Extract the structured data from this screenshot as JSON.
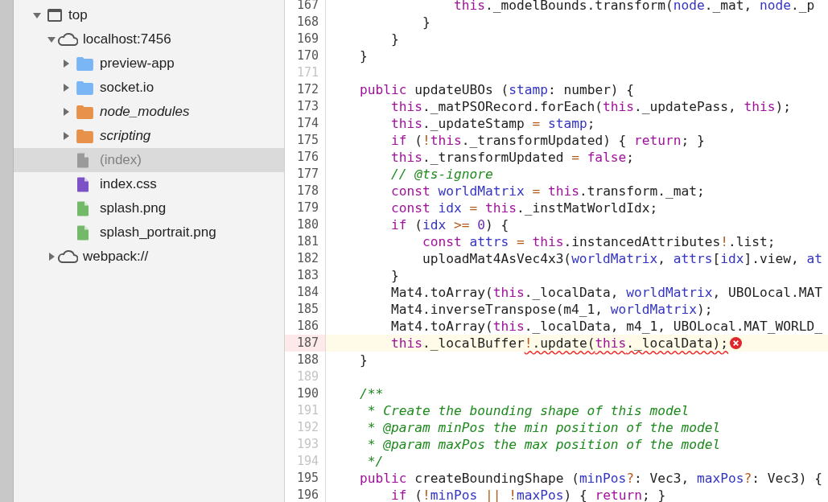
{
  "navigator": {
    "tree": [
      {
        "label": "top",
        "kind": "frame",
        "expanded": true,
        "selected": false,
        "italic": false,
        "children": [
          {
            "label": "localhost:7456",
            "kind": "origin",
            "expanded": true,
            "selected": false,
            "italic": false,
            "children": [
              {
                "label": "preview-app",
                "kind": "folder",
                "expanded": false,
                "selected": false,
                "italic": false,
                "color": "#7ab6f5"
              },
              {
                "label": "socket.io",
                "kind": "folder",
                "expanded": false,
                "selected": false,
                "italic": false,
                "color": "#7ab6f5"
              },
              {
                "label": "node_modules",
                "kind": "folder",
                "expanded": false,
                "selected": false,
                "italic": true,
                "color": "#e8914a"
              },
              {
                "label": "scripting",
                "kind": "folder",
                "expanded": false,
                "selected": false,
                "italic": true,
                "color": "#e8914a"
              },
              {
                "label": "(index)",
                "kind": "file",
                "selected": true,
                "italic": false,
                "color": "#9a9a9a"
              },
              {
                "label": "index.css",
                "kind": "file",
                "selected": false,
                "italic": false,
                "color": "#7d52c7"
              },
              {
                "label": "splash.png",
                "kind": "file",
                "selected": false,
                "italic": false,
                "color": "#74b86a"
              },
              {
                "label": "splash_portrait.png",
                "kind": "file",
                "selected": false,
                "italic": false,
                "color": "#74b86a"
              }
            ]
          },
          {
            "label": "webpack://",
            "kind": "origin",
            "expanded": false,
            "selected": false,
            "italic": false
          }
        ]
      }
    ]
  },
  "editor": {
    "lines": [
      {
        "n": "167",
        "dim": false,
        "error": false,
        "tokens": [
          {
            "t": "                this",
            "kind": "keyword"
          },
          {
            "t": "._modelBounds.transform(",
            "kind": "plain"
          },
          {
            "t": "node",
            "kind": "variable"
          },
          {
            "t": "._mat, ",
            "kind": "plain"
          },
          {
            "t": "node",
            "kind": "variable"
          },
          {
            "t": "._p",
            "kind": "plain"
          }
        ]
      },
      {
        "n": "168",
        "dim": false,
        "error": false,
        "tokens": [
          {
            "t": "            }",
            "kind": "plain"
          }
        ]
      },
      {
        "n": "169",
        "dim": false,
        "error": false,
        "tokens": [
          {
            "t": "        }",
            "kind": "plain"
          }
        ]
      },
      {
        "n": "170",
        "dim": false,
        "error": false,
        "tokens": [
          {
            "t": "    }",
            "kind": "plain"
          }
        ]
      },
      {
        "n": "171",
        "dim": true,
        "error": false
      },
      {
        "n": "172",
        "dim": false,
        "error": false,
        "tokens": [
          {
            "t": "    public",
            "kind": "keyword"
          },
          {
            "t": " updateUBOs (",
            "kind": "plain"
          },
          {
            "t": "stamp",
            "kind": "variable"
          },
          {
            "t": ": number) {",
            "kind": "plain"
          }
        ]
      },
      {
        "n": "173",
        "dim": false,
        "error": false,
        "tokens": [
          {
            "t": "        this",
            "kind": "keyword"
          },
          {
            "t": "._matPSORecord.forEach(",
            "kind": "plain"
          },
          {
            "t": "this",
            "kind": "keyword"
          },
          {
            "t": "._updatePass, ",
            "kind": "plain"
          },
          {
            "t": "this",
            "kind": "keyword"
          },
          {
            "t": ");",
            "kind": "plain"
          }
        ]
      },
      {
        "n": "174",
        "dim": false,
        "error": false,
        "tokens": [
          {
            "t": "        this",
            "kind": "keyword"
          },
          {
            "t": "._updateStamp ",
            "kind": "plain"
          },
          {
            "t": "= ",
            "kind": "operator"
          },
          {
            "t": "stamp",
            "kind": "variable"
          },
          {
            "t": ";",
            "kind": "plain"
          }
        ]
      },
      {
        "n": "175",
        "dim": false,
        "error": false,
        "tokens": [
          {
            "t": "        if",
            "kind": "keyword"
          },
          {
            "t": " (",
            "kind": "plain"
          },
          {
            "t": "!",
            "kind": "operator"
          },
          {
            "t": "this",
            "kind": "keyword"
          },
          {
            "t": "._transformUpdated) { ",
            "kind": "plain"
          },
          {
            "t": "return",
            "kind": "keyword"
          },
          {
            "t": "; }",
            "kind": "plain"
          }
        ]
      },
      {
        "n": "176",
        "dim": false,
        "error": false,
        "tokens": [
          {
            "t": "        this",
            "kind": "keyword"
          },
          {
            "t": "._transformUpdated ",
            "kind": "plain"
          },
          {
            "t": "= ",
            "kind": "operator"
          },
          {
            "t": "false",
            "kind": "keyword"
          },
          {
            "t": ";",
            "kind": "plain"
          }
        ]
      },
      {
        "n": "177",
        "dim": false,
        "error": false,
        "tokens": [
          {
            "t": "        // @ts-ignore",
            "kind": "comment"
          }
        ]
      },
      {
        "n": "178",
        "dim": false,
        "error": false,
        "tokens": [
          {
            "t": "        const",
            "kind": "keyword"
          },
          {
            "t": " worldMatrix",
            "kind": "variable"
          },
          {
            "t": " = ",
            "kind": "operator"
          },
          {
            "t": "this",
            "kind": "keyword"
          },
          {
            "t": ".transform._mat;",
            "kind": "plain"
          }
        ]
      },
      {
        "n": "179",
        "dim": false,
        "error": false,
        "tokens": [
          {
            "t": "        const",
            "kind": "keyword"
          },
          {
            "t": " idx",
            "kind": "variable"
          },
          {
            "t": " = ",
            "kind": "operator"
          },
          {
            "t": "this",
            "kind": "keyword"
          },
          {
            "t": "._instMatWorldIdx;",
            "kind": "plain"
          }
        ]
      },
      {
        "n": "180",
        "dim": false,
        "error": false,
        "tokens": [
          {
            "t": "        if",
            "kind": "keyword"
          },
          {
            "t": " (",
            "kind": "plain"
          },
          {
            "t": "idx",
            "kind": "variable"
          },
          {
            "t": " >= ",
            "kind": "operator"
          },
          {
            "t": "0",
            "kind": "number"
          },
          {
            "t": ") {",
            "kind": "plain"
          }
        ]
      },
      {
        "n": "181",
        "dim": false,
        "error": false,
        "tokens": [
          {
            "t": "            const",
            "kind": "keyword"
          },
          {
            "t": " attrs",
            "kind": "variable"
          },
          {
            "t": " = ",
            "kind": "operator"
          },
          {
            "t": "this",
            "kind": "keyword"
          },
          {
            "t": ".instancedAttributes",
            "kind": "plain"
          },
          {
            "t": "!",
            "kind": "operator"
          },
          {
            "t": ".list;",
            "kind": "plain"
          }
        ]
      },
      {
        "n": "182",
        "dim": false,
        "error": false,
        "tokens": [
          {
            "t": "            uploadMat4AsVec4x3(",
            "kind": "plain"
          },
          {
            "t": "worldMatrix",
            "kind": "variable"
          },
          {
            "t": ", ",
            "kind": "plain"
          },
          {
            "t": "attrs",
            "kind": "variable"
          },
          {
            "t": "[",
            "kind": "plain"
          },
          {
            "t": "idx",
            "kind": "variable"
          },
          {
            "t": "].view, ",
            "kind": "plain"
          },
          {
            "t": "at",
            "kind": "variable"
          }
        ]
      },
      {
        "n": "183",
        "dim": false,
        "error": false,
        "tokens": [
          {
            "t": "        }",
            "kind": "plain"
          }
        ]
      },
      {
        "n": "184",
        "dim": false,
        "error": false,
        "tokens": [
          {
            "t": "        Mat4.toArray(",
            "kind": "plain"
          },
          {
            "t": "this",
            "kind": "keyword"
          },
          {
            "t": "._localData, ",
            "kind": "plain"
          },
          {
            "t": "worldMatrix",
            "kind": "variable"
          },
          {
            "t": ", UBOLocal.MAT",
            "kind": "plain"
          }
        ]
      },
      {
        "n": "185",
        "dim": false,
        "error": false,
        "tokens": [
          {
            "t": "        Mat4.inverseTranspose(m4_1, ",
            "kind": "plain"
          },
          {
            "t": "worldMatrix",
            "kind": "variable"
          },
          {
            "t": ");",
            "kind": "plain"
          }
        ]
      },
      {
        "n": "186",
        "dim": false,
        "error": false,
        "tokens": [
          {
            "t": "        Mat4.toArray(",
            "kind": "plain"
          },
          {
            "t": "this",
            "kind": "keyword"
          },
          {
            "t": "._localData, m4_1, UBOLocal.MAT_WORLD_",
            "kind": "plain"
          }
        ]
      },
      {
        "n": "187",
        "dim": false,
        "error": true,
        "tokens": [
          {
            "t": "        this",
            "kind": "keyword"
          },
          {
            "t": "._localBuffer",
            "kind": "plain",
            "squiggle": false
          },
          {
            "t": "!",
            "kind": "operator",
            "squiggle": true
          },
          {
            "t": ".update(",
            "kind": "plain",
            "squiggle": true
          },
          {
            "t": "this",
            "kind": "keyword",
            "squiggle": true
          },
          {
            "t": "._localData);",
            "kind": "plain",
            "squiggle": true
          }
        ]
      },
      {
        "n": "188",
        "dim": false,
        "error": false,
        "tokens": [
          {
            "t": "    }",
            "kind": "plain"
          }
        ]
      },
      {
        "n": "189",
        "dim": true,
        "error": false
      },
      {
        "n": "190",
        "dim": false,
        "error": false,
        "tokens": [
          {
            "t": "    /**",
            "kind": "comment"
          }
        ]
      },
      {
        "n": "191",
        "dim": true,
        "error": false,
        "tokens": [
          {
            "t": "     * Create the bounding shape of this model",
            "kind": "comment"
          }
        ]
      },
      {
        "n": "192",
        "dim": true,
        "error": false,
        "tokens": [
          {
            "t": "     * @param minPos the min position of the model",
            "kind": "comment"
          }
        ]
      },
      {
        "n": "193",
        "dim": true,
        "error": false,
        "tokens": [
          {
            "t": "     * @param maxPos the max position of the model",
            "kind": "comment"
          }
        ]
      },
      {
        "n": "194",
        "dim": true,
        "error": false,
        "tokens": [
          {
            "t": "     */",
            "kind": "comment"
          }
        ]
      },
      {
        "n": "195",
        "dim": false,
        "error": false,
        "tokens": [
          {
            "t": "    public",
            "kind": "keyword"
          },
          {
            "t": " createBoundingShape (",
            "kind": "plain"
          },
          {
            "t": "minPos",
            "kind": "variable"
          },
          {
            "t": "?",
            "kind": "operator"
          },
          {
            "t": ": Vec3, ",
            "kind": "plain"
          },
          {
            "t": "maxPos",
            "kind": "variable"
          },
          {
            "t": "?",
            "kind": "operator"
          },
          {
            "t": ": Vec3) {",
            "kind": "plain"
          }
        ]
      },
      {
        "n": "196",
        "dim": false,
        "error": false,
        "tokens": [
          {
            "t": "        if",
            "kind": "keyword"
          },
          {
            "t": " (",
            "kind": "plain"
          },
          {
            "t": "!",
            "kind": "operator"
          },
          {
            "t": "minPos",
            "kind": "variable"
          },
          {
            "t": " || ",
            "kind": "operator"
          },
          {
            "t": "!",
            "kind": "operator"
          },
          {
            "t": "maxPos",
            "kind": "variable"
          },
          {
            "t": ") { ",
            "kind": "plain"
          },
          {
            "t": "return",
            "kind": "keyword"
          },
          {
            "t": "; }",
            "kind": "plain"
          }
        ]
      }
    ]
  }
}
